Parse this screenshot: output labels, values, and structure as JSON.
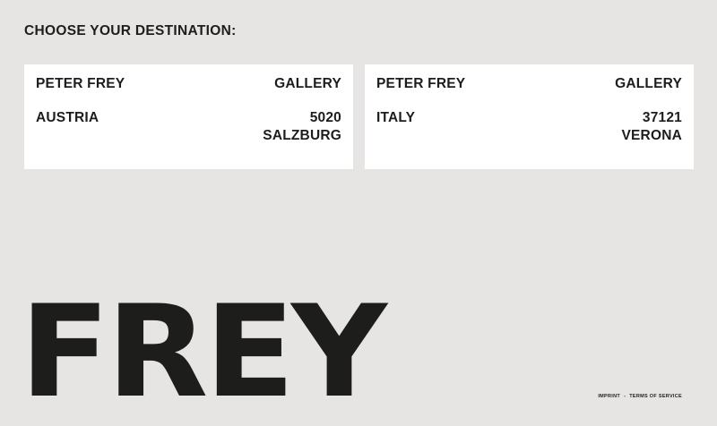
{
  "heading": "CHOOSE YOUR DESTINATION:",
  "destinations": [
    {
      "name": "PETER FREY",
      "type": "GALLERY",
      "country": "AUSTRIA",
      "postal_code": "5020",
      "city": "SALZBURG"
    },
    {
      "name": "PETER FREY",
      "type": "GALLERY",
      "country": "ITALY",
      "postal_code": "37121",
      "city": "VERONA"
    }
  ],
  "logo_text": "FREY",
  "footer": {
    "imprint": "IMPRINT",
    "separator": "-",
    "terms": "TERMS OF SERVICE"
  }
}
